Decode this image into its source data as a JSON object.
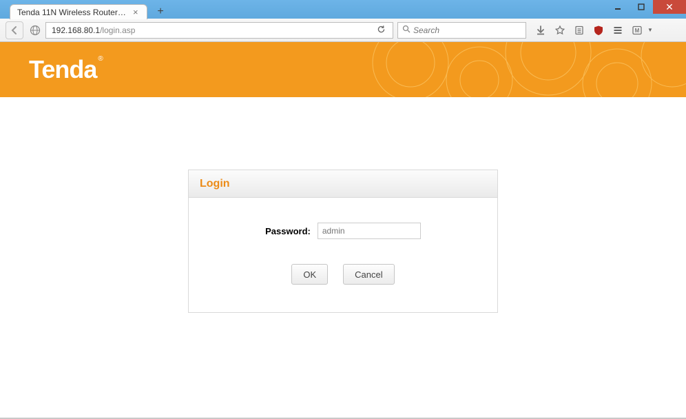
{
  "window": {
    "tab_title": "Tenda 11N Wireless Router Lo..."
  },
  "toolbar": {
    "url_host": "192.168.80.1",
    "url_path": "/login.asp",
    "search_placeholder": "Search"
  },
  "page": {
    "brand": "Tenda",
    "login": {
      "header": "Login",
      "password_label": "Password:",
      "password_placeholder": "admin",
      "ok_label": "OK",
      "cancel_label": "Cancel"
    }
  }
}
